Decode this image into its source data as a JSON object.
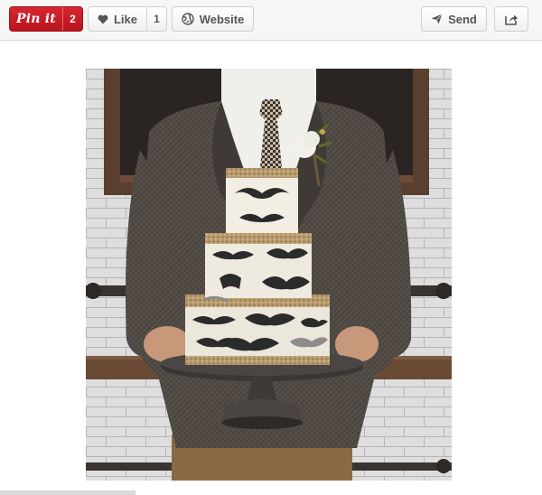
{
  "toolbar": {
    "pin_label": "Pin it",
    "pin_count": "2",
    "like_label": "Like",
    "like_count": "1",
    "website_label": "Website",
    "send_label": "Send"
  },
  "icons": {
    "like": "heart-icon",
    "website": "globe-icon",
    "send": "paper-plane-icon",
    "share": "share-box-icon"
  },
  "colors": {
    "pin_red": "#cb2027",
    "toolbar_bg": "#f6f6f6"
  }
}
